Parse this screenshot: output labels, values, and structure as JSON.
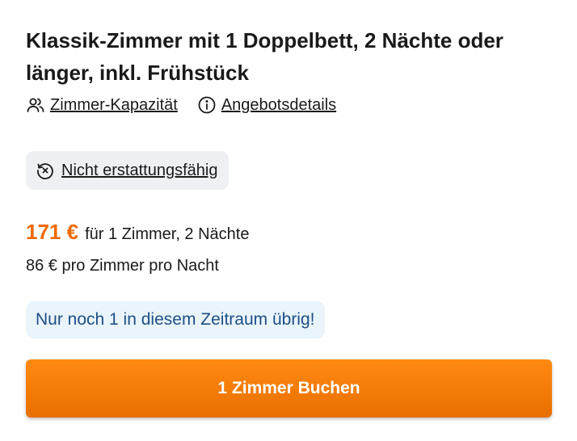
{
  "offer": {
    "title": "Klassik-Zimmer mit 1 Doppelbett, 2 Nächte oder länger, inkl. Frühstück",
    "links": [
      {
        "label": "Zimmer-Kapazität",
        "icon": "people-icon"
      },
      {
        "label": "Angebotsdetails",
        "icon": "info-icon"
      }
    ],
    "refund_label": "Nicht erstattungsfähig",
    "refund_icon": "no-refund-clock-icon",
    "price": "171 €",
    "price_desc": "für 1 Zimmer, 2 Nächte",
    "per_night": "86 € pro Zimmer pro Nacht",
    "availability": "Nur noch 1 in diesem Zeitraum übrig!",
    "book_label": "1 Zimmer Buchen"
  },
  "colors": {
    "price": "#ee6a00",
    "button_top": "#ff8a12",
    "button_bottom": "#e86f00",
    "availability_bg": "#eaf4fb",
    "availability_text": "#1d4f86",
    "refund_bg": "#eef0f3"
  }
}
